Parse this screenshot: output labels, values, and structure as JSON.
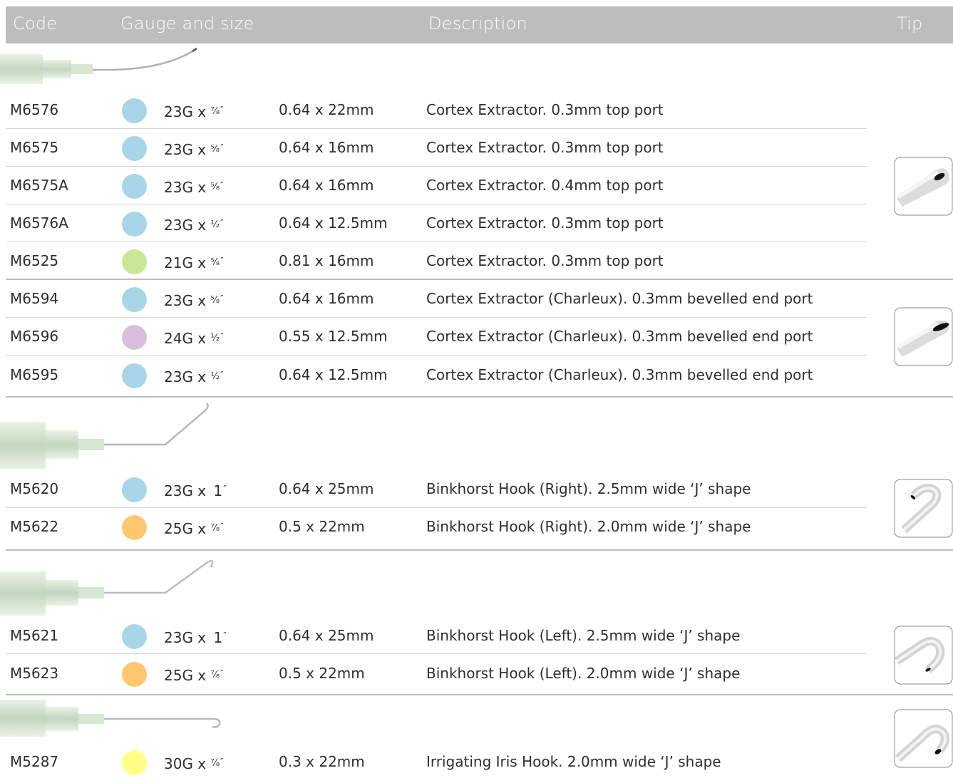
{
  "header": {
    "code": "Code",
    "gauge": "Gauge and size",
    "description": "Description",
    "tip": "Tip"
  },
  "gauge_colors": {
    "23G": "#a8d6e6",
    "21G": "#c8e898",
    "24G": "#d8c0dc",
    "25G": "#ffc870",
    "30G": "#ffff88"
  },
  "rows": [
    {
      "code": "M6576",
      "gauge": "23G x ",
      "frac": "⁷⁄₈",
      "size": "0.64 x 22mm",
      "desc": "Cortex Extractor. 0.3mm top port",
      "color": "#a8d6e6"
    },
    {
      "code": "M6575",
      "gauge": "23G x ",
      "frac": "⁵⁄₈",
      "size": "0.64 x 16mm",
      "desc": "Cortex Extractor. 0.3mm top port",
      "color": "#a8d6e6"
    },
    {
      "code": "M6575A",
      "gauge": "23G x ",
      "frac": "⁵⁄₈",
      "size": "0.64 x 16mm",
      "desc": "Cortex Extractor. 0.4mm top port",
      "color": "#a8d6e6"
    },
    {
      "code": "M6576A",
      "gauge": "23G x ",
      "frac": "¹⁄₂",
      "size": "0.64 x 12.5mm",
      "desc": "Cortex Extractor. 0.3mm top port",
      "color": "#a8d6e6"
    },
    {
      "code": "M6525",
      "gauge": "21G x ",
      "frac": "⁵⁄₈",
      "size": "0.81 x 16mm",
      "desc": "Cortex Extractor. 0.3mm top port",
      "color": "#c8e898"
    },
    {
      "code": "M6594",
      "gauge": "23G x ",
      "frac": "⁵⁄₈",
      "size": "0.64 x 16mm",
      "desc": "Cortex Extractor (Charleux). 0.3mm bevelled end port",
      "color": "#a8d6e6"
    },
    {
      "code": "M6596",
      "gauge": "24G x ",
      "frac": "¹⁄₂",
      "size": "0.55 x 12.5mm",
      "desc": "Cortex Extractor (Charleux). 0.3mm bevelled end port",
      "color": "#d8c0dc"
    },
    {
      "code": "M6595",
      "gauge": "23G x ",
      "frac": "¹⁄₂",
      "size": "0.64 x 12.5mm",
      "desc": "Cortex Extractor (Charleux). 0.3mm bevelled end port",
      "color": "#a8d6e6"
    },
    {
      "code": "M5620",
      "gauge": "23G x ",
      "frac": "1",
      "size": "0.64 x 25mm",
      "desc": "Binkhorst Hook (Right). 2.5mm wide ‘J’ shape",
      "color": "#a8d6e6"
    },
    {
      "code": "M5622",
      "gauge": "25G x ",
      "frac": "⁷⁄₈",
      "size": "0.5 x 22mm",
      "desc": "Binkhorst Hook (Right). 2.0mm wide ‘J’ shape",
      "color": "#ffc870"
    },
    {
      "code": "M5621",
      "gauge": "23G x ",
      "frac": "1",
      "size": "0.64 x 25mm",
      "desc": "Binkhorst Hook (Left). 2.5mm wide ‘J’ shape",
      "color": "#a8d6e6"
    },
    {
      "code": "M5623",
      "gauge": "25G x ",
      "frac": "⁷⁄₈",
      "size": "0.5 x 22mm",
      "desc": "Binkhorst Hook (Left). 2.0mm wide ‘J’ shape",
      "color": "#ffc870"
    },
    {
      "code": "M5287",
      "gauge": "30G x ",
      "frac": "⁷⁄₈",
      "size": "0.3 x 22mm",
      "desc": "Irrigating Iris Hook. 2.0mm wide ‘J’ shape",
      "color": "#ffff88"
    }
  ],
  "inch_mark": "″"
}
